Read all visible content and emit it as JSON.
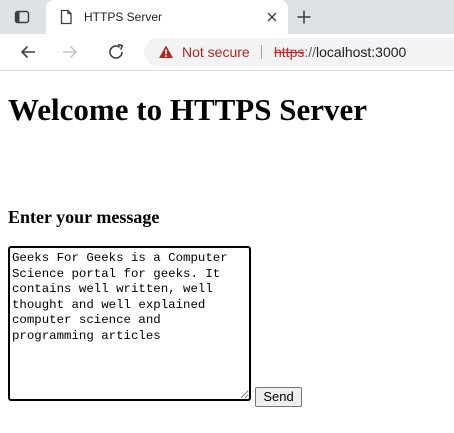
{
  "browser": {
    "tab": {
      "title": "HTTPS Server"
    },
    "address_bar": {
      "security_label": "Not secure",
      "url_scheme": "https",
      "url_separator": "://",
      "url_host": "localhost:3000"
    }
  },
  "page": {
    "heading": "Welcome to HTTPS Server",
    "message_label": "Enter your message",
    "message_value": "Geeks For Geeks is a Computer Science portal for geeks. It contains well written, well thought and well explained computer science and programming articles",
    "send_label": "Send"
  },
  "colors": {
    "tabstrip": "#dee1e6",
    "omnibox": "#f1f3f4",
    "warning": "#b3261e"
  },
  "icons": [
    "tab-actions-icon",
    "page-icon",
    "close-icon",
    "plus-icon",
    "back-arrow-icon",
    "forward-arrow-icon",
    "reload-icon",
    "warning-icon"
  ]
}
